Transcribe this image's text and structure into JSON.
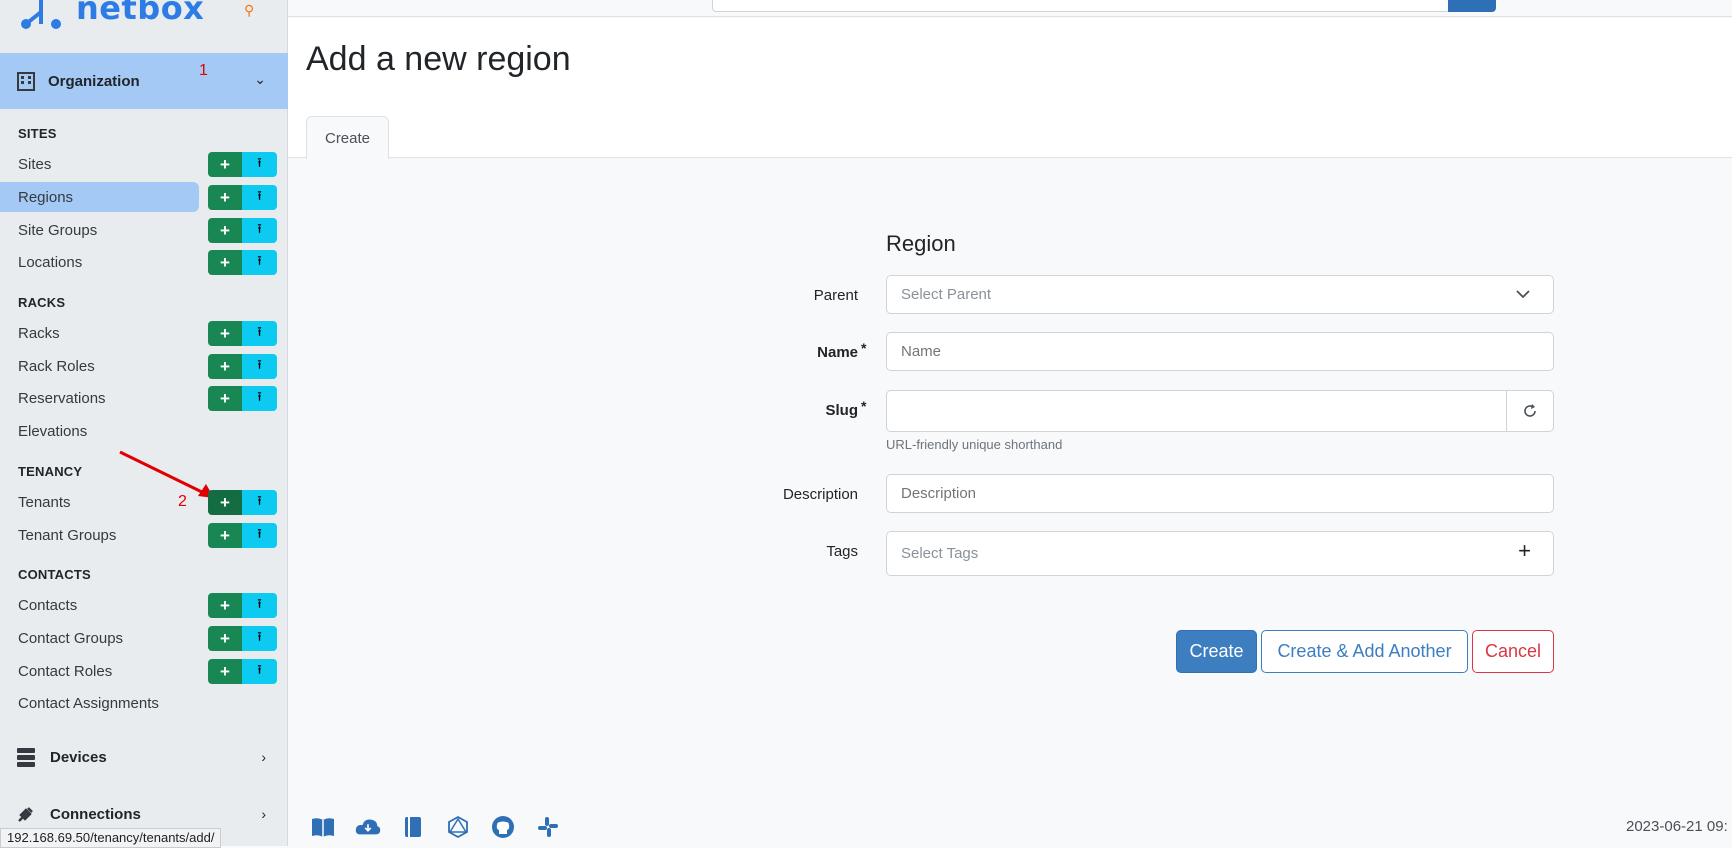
{
  "app": {
    "logo_text": "netbox"
  },
  "sidebar": {
    "org_title": "Organization",
    "annotation_1": "1",
    "annotation_2": "2",
    "sections": {
      "sites": "SITES",
      "racks": "RACKS",
      "tenancy": "TENANCY",
      "contacts": "CONTACTS"
    },
    "items": {
      "sites": "Sites",
      "regions": "Regions",
      "site_groups": "Site Groups",
      "locations": "Locations",
      "racks": "Racks",
      "rack_roles": "Rack Roles",
      "reservations": "Reservations",
      "elevations": "Elevations",
      "tenants": "Tenants",
      "tenant_groups": "Tenant Groups",
      "contacts": "Contacts",
      "contact_groups": "Contact Groups",
      "contact_roles": "Contact Roles",
      "contact_assignments": "Contact Assignments"
    },
    "add_symbol": "+",
    "import_symbol": "⭱",
    "groups": {
      "devices": "Devices",
      "connections": "Connections"
    }
  },
  "status_url": "192.168.69.50/tenancy/tenants/add/",
  "page": {
    "title": "Add a new region",
    "tab_create": "Create"
  },
  "form": {
    "section_title": "Region",
    "parent_label": "Parent",
    "parent_placeholder": "Select Parent",
    "name_label": "Name",
    "name_placeholder": "Name",
    "slug_label": "Slug",
    "slug_value": "",
    "slug_help": "URL-friendly unique shorthand",
    "description_label": "Description",
    "description_placeholder": "Description",
    "tags_label": "Tags",
    "tags_placeholder": "Select Tags",
    "required_mark": "*",
    "create_button": "Create",
    "create_another_button": "Create & Add Another",
    "cancel_button": "Cancel"
  },
  "footer": {
    "icons": [
      "docs-icon",
      "rest-api-icon",
      "api-docs-icon",
      "graphql-icon",
      "github-icon",
      "slack-icon"
    ],
    "timestamp": "2023-06-21 09:"
  },
  "colors": {
    "accent": "#3d7ec1",
    "add": "#198754",
    "import": "#0dcaf0",
    "active": "#a5c9f5"
  }
}
